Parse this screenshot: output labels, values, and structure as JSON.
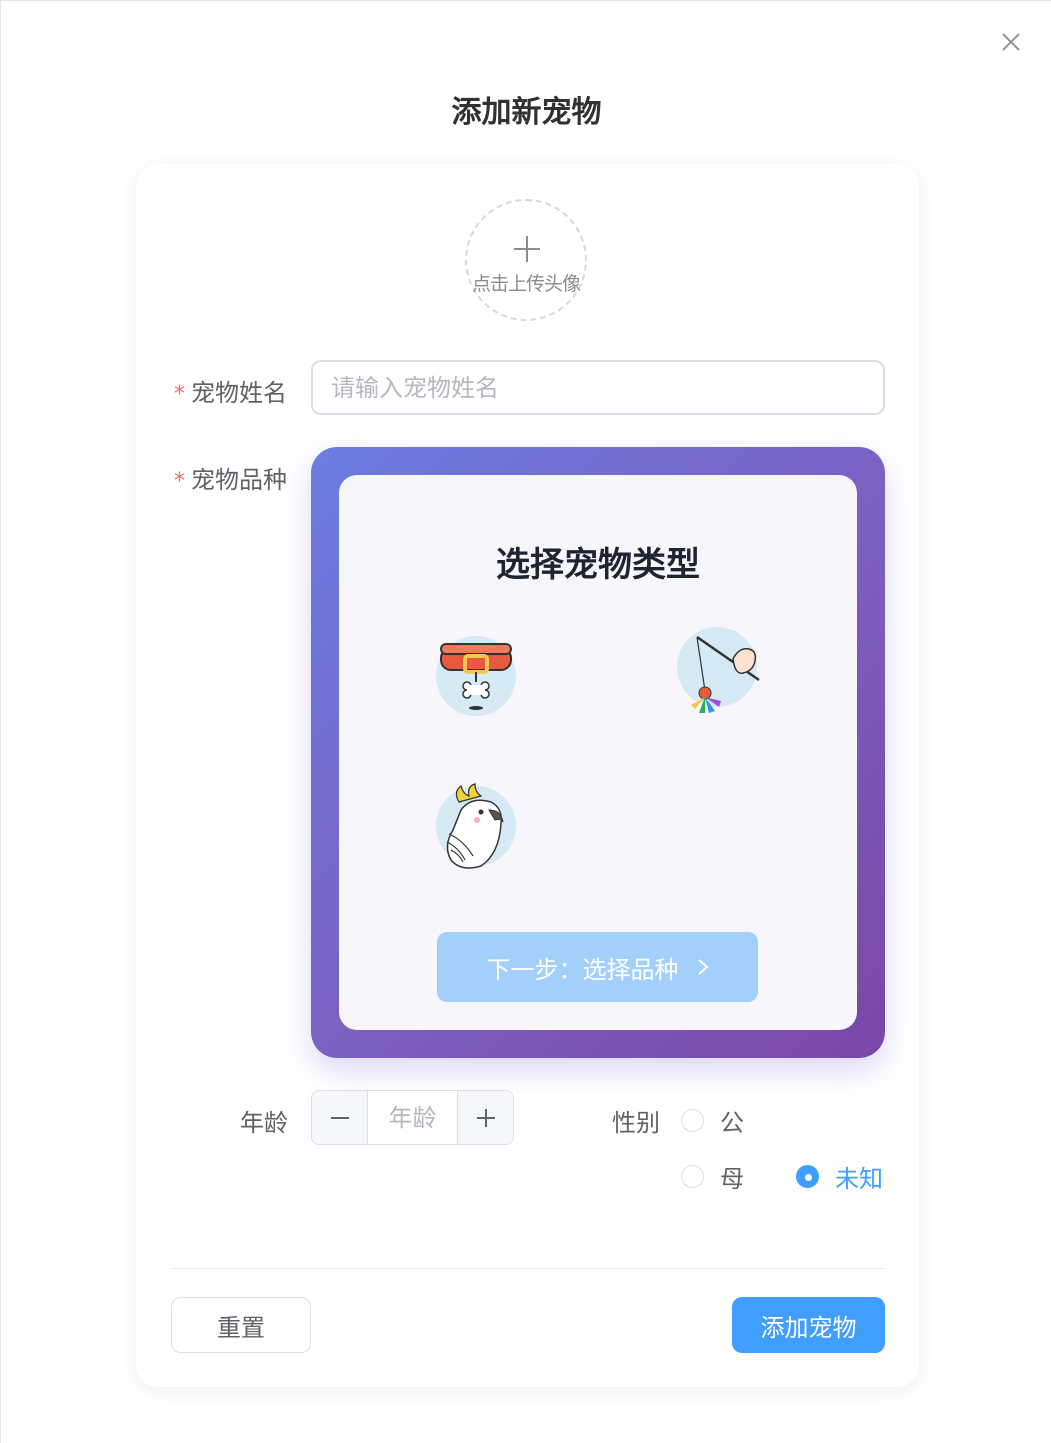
{
  "dialog": {
    "title": "添加新宠物",
    "close_icon": "close-icon"
  },
  "avatar": {
    "upload_text": "点击上传头像",
    "icon": "plus-icon"
  },
  "form": {
    "name": {
      "label": "宠物姓名",
      "required_mark": "*",
      "placeholder": "请输入宠物姓名",
      "value": ""
    },
    "species": {
      "label": "宠物品种",
      "required_mark": "*",
      "panel_title": "选择宠物类型",
      "options": [
        {
          "icon": "dog-collar-icon"
        },
        {
          "icon": "cat-toy-icon"
        },
        {
          "icon": "parrot-icon"
        }
      ],
      "next_button": "下一步：选择品种",
      "next_icon": "chevron-right-icon"
    },
    "age": {
      "label": "年龄",
      "placeholder": "年龄",
      "value": ""
    },
    "gender": {
      "label": "性别",
      "options": [
        {
          "label": "公",
          "checked": false
        },
        {
          "label": "母",
          "checked": false
        },
        {
          "label": "未知",
          "checked": true
        }
      ]
    }
  },
  "footer": {
    "reset_label": "重置",
    "submit_label": "添加宠物"
  },
  "colors": {
    "primary": "#409eff",
    "next_button_disabled": "#a3d0fb",
    "required": "#f56c6c",
    "gradient_start": "#6b7de1",
    "gradient_end": "#7a47a6"
  }
}
